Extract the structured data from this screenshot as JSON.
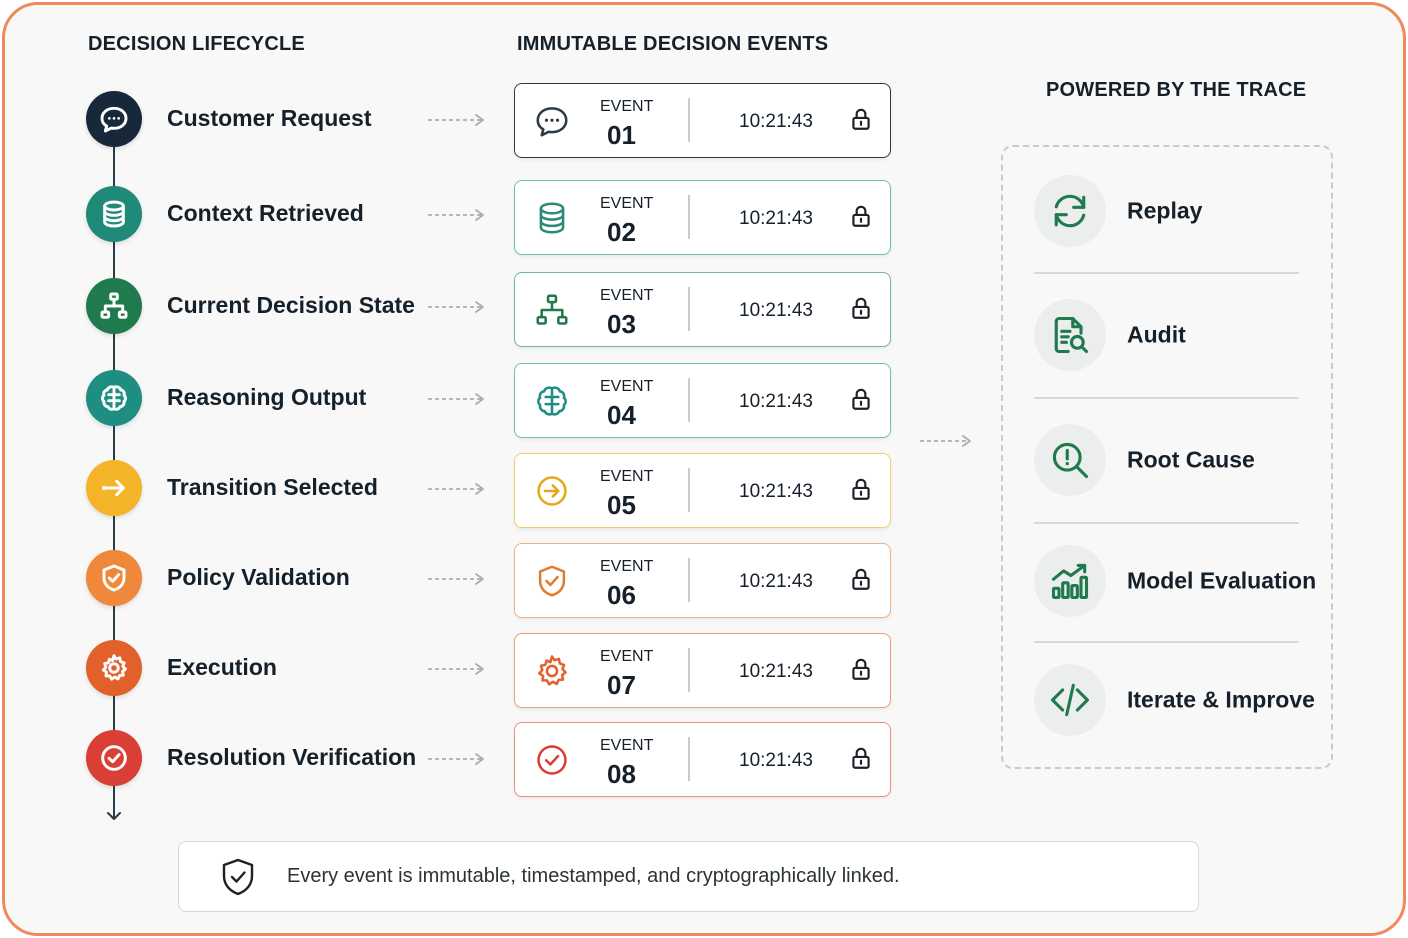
{
  "headings": {
    "lifecycle": "DECISION LIFECYCLE",
    "events": "IMMUTABLE DECISION EVENTS",
    "powered": "POWERED BY THE TRACE"
  },
  "lifecycle": [
    {
      "label": "Customer Request",
      "icon": "chat-bubble-icon",
      "color": "#17283a"
    },
    {
      "label": "Context Retrieved",
      "icon": "database-icon",
      "color": "#1f8a78"
    },
    {
      "label": "Current Decision State",
      "icon": "hierarchy-icon",
      "color": "#1f7a4e"
    },
    {
      "label": "Reasoning Output",
      "icon": "brain-icon",
      "color": "#1f8e82"
    },
    {
      "label": "Transition Selected",
      "icon": "arrow-right-icon",
      "color": "#f3b429"
    },
    {
      "label": "Policy Validation",
      "icon": "shield-check-icon",
      "color": "#f0883b"
    },
    {
      "label": "Execution",
      "icon": "gear-icon",
      "color": "#e2602a"
    },
    {
      "label": "Resolution Verification",
      "icon": "check-circle-icon",
      "color": "#da3f36"
    }
  ],
  "events": [
    {
      "word": "EVENT",
      "number": "01",
      "time": "10:21:43",
      "border": "#2d3a44",
      "icon": "chat-bubble-icon",
      "icon_color": "#2d3a44"
    },
    {
      "word": "EVENT",
      "number": "02",
      "time": "10:21:43",
      "border": "#6fc0ad",
      "icon": "database-icon",
      "icon_color": "#2a8a76"
    },
    {
      "word": "EVENT",
      "number": "03",
      "time": "10:21:43",
      "border": "#6fb993",
      "icon": "hierarchy-icon",
      "icon_color": "#1f7a4e"
    },
    {
      "word": "EVENT",
      "number": "04",
      "time": "10:21:43",
      "border": "#6fbfb4",
      "icon": "brain-icon",
      "icon_color": "#1f8e82"
    },
    {
      "word": "EVENT",
      "number": "05",
      "time": "10:21:43",
      "border": "#f2cf6c",
      "icon": "arrow-right-icon",
      "icon_color": "#e6a817"
    },
    {
      "word": "EVENT",
      "number": "06",
      "time": "10:21:43",
      "border": "#f1b37e",
      "icon": "shield-check-icon",
      "icon_color": "#e37b2c"
    },
    {
      "word": "EVENT",
      "number": "07",
      "time": "10:21:43",
      "border": "#ee9e76",
      "icon": "gear-icon",
      "icon_color": "#e2602a"
    },
    {
      "word": "EVENT",
      "number": "08",
      "time": "10:21:43",
      "border": "#ec8f86",
      "icon": "check-circle-icon",
      "icon_color": "#da3f36"
    }
  ],
  "powered": [
    {
      "label": "Replay",
      "icon": "refresh-icon"
    },
    {
      "label": "Audit",
      "icon": "document-search-icon"
    },
    {
      "label": "Root Cause",
      "icon": "magnifier-alert-icon"
    },
    {
      "label": "Model Evaluation",
      "icon": "bar-chart-trend-icon"
    },
    {
      "label": "Iterate & Improve",
      "icon": "code-icon"
    }
  ],
  "footer": {
    "text": "Every event is immutable, timestamped, and cryptographically linked.",
    "icon": "shield-check-icon"
  },
  "colors": {
    "frame": "#f08a5d",
    "powered_icon": "#1f7a4e",
    "text": "#16202a"
  }
}
